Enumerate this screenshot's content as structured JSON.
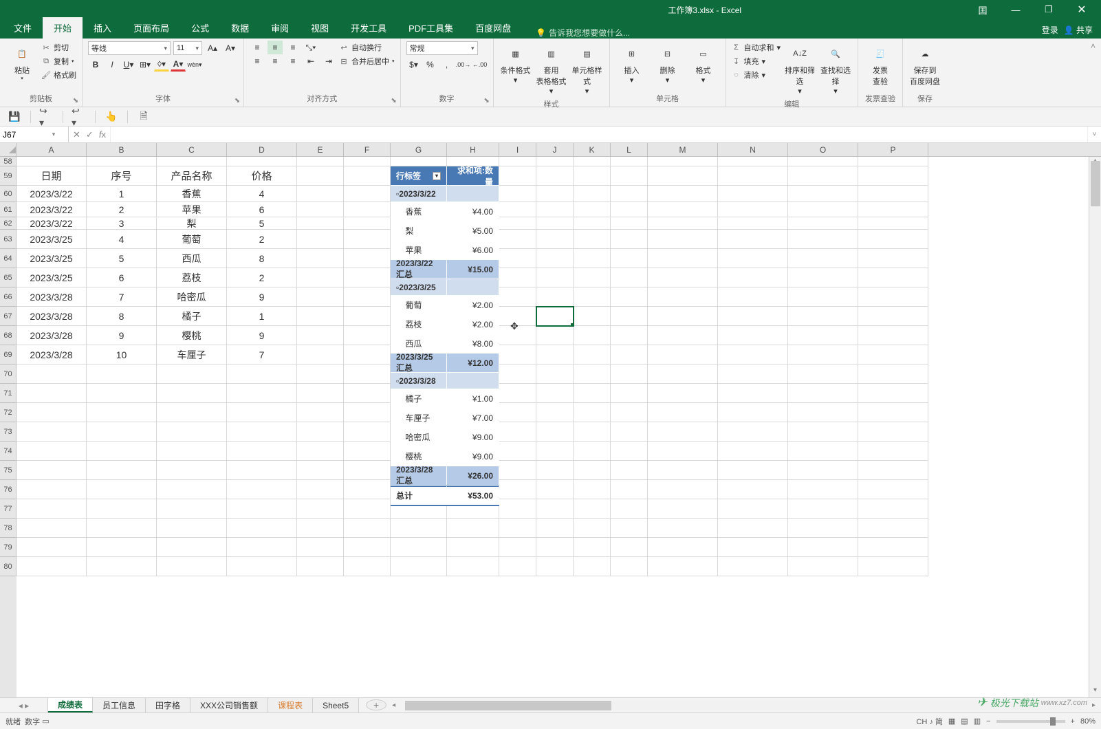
{
  "title": {
    "filename": "工作簿3.xlsx",
    "app": "Excel"
  },
  "window_buttons": {
    "account": "囯",
    "min": "—",
    "max": "❐",
    "close": "✕"
  },
  "menu_tabs": [
    "文件",
    "开始",
    "插入",
    "页面布局",
    "公式",
    "数据",
    "审阅",
    "视图",
    "开发工具",
    "PDF工具集",
    "百度网盘"
  ],
  "menu_active": "开始",
  "tell_me": "告诉我您想要做什么...",
  "login": "登录",
  "share": "共享",
  "ribbon": {
    "clipboard": {
      "paste": "粘贴",
      "cut": "剪切",
      "copy": "复制",
      "format_painter": "格式刷",
      "group": "剪贴板"
    },
    "font": {
      "name": "等线",
      "size": "11",
      "group": "字体"
    },
    "align": {
      "wrap": "自动换行",
      "merge": "合并后居中",
      "group": "对齐方式"
    },
    "number": {
      "format": "常规",
      "group": "数字"
    },
    "styles": {
      "cond": "条件格式",
      "table": "套用\n表格格式",
      "cell": "单元格样式",
      "group": "样式"
    },
    "cells": {
      "insert": "插入",
      "delete": "删除",
      "format": "格式",
      "group": "单元格"
    },
    "editing": {
      "sum": "自动求和",
      "fill": "填充",
      "clear": "清除",
      "sort": "排序和筛选",
      "find": "查找和选择",
      "group": "编辑"
    },
    "invoice": {
      "label": "发票\n查验",
      "group": "发票查验"
    },
    "save": {
      "label": "保存到\n百度网盘",
      "group": "保存"
    }
  },
  "namebox": "J67",
  "columns": [
    "A",
    "B",
    "C",
    "D",
    "E",
    "F",
    "G",
    "H",
    "I",
    "J",
    "K",
    "L",
    "M",
    "N",
    "O",
    "P"
  ],
  "row_labels": [
    "58",
    "59",
    "60",
    "61",
    "62",
    "63",
    "64",
    "65",
    "66",
    "67",
    "68",
    "69",
    "70",
    "71",
    "72",
    "73",
    "74",
    "75",
    "76",
    "77",
    "78",
    "79",
    "80"
  ],
  "table_headers": {
    "A": "日期",
    "B": "序号",
    "C": "产品名称",
    "D": "价格"
  },
  "table_rows": [
    {
      "A": "2023/3/22",
      "B": "1",
      "C": "香蕉",
      "D": "4"
    },
    {
      "A": "2023/3/22",
      "B": "2",
      "C": "苹果",
      "D": "6"
    },
    {
      "A": "2023/3/22",
      "B": "3",
      "C": "梨",
      "D": "5"
    },
    {
      "A": "2023/3/25",
      "B": "4",
      "C": "葡萄",
      "D": "2"
    },
    {
      "A": "2023/3/25",
      "B": "5",
      "C": "西瓜",
      "D": "8"
    },
    {
      "A": "2023/3/25",
      "B": "6",
      "C": "荔枝",
      "D": "2"
    },
    {
      "A": "2023/3/28",
      "B": "7",
      "C": "哈密瓜",
      "D": "9"
    },
    {
      "A": "2023/3/28",
      "B": "8",
      "C": "橘子",
      "D": "1"
    },
    {
      "A": "2023/3/28",
      "B": "9",
      "C": "樱桃",
      "D": "9"
    },
    {
      "A": "2023/3/28",
      "B": "10",
      "C": "车厘子",
      "D": "7"
    }
  ],
  "pivot": {
    "row_label": "行标签",
    "val_label": "求和项:数量",
    "groups": [
      {
        "date": "2023/3/22",
        "items": [
          {
            "n": "香蕉",
            "v": "¥4.00"
          },
          {
            "n": "梨",
            "v": "¥5.00"
          },
          {
            "n": "苹果",
            "v": "¥6.00"
          }
        ],
        "subtotal_label": "2023/3/22 汇总",
        "subtotal": "¥15.00"
      },
      {
        "date": "2023/3/25",
        "items": [
          {
            "n": "葡萄",
            "v": "¥2.00"
          },
          {
            "n": "荔枝",
            "v": "¥2.00"
          },
          {
            "n": "西瓜",
            "v": "¥8.00"
          }
        ],
        "subtotal_label": "2023/3/25 汇总",
        "subtotal": "¥12.00"
      },
      {
        "date": "2023/3/28",
        "items": [
          {
            "n": "橘子",
            "v": "¥1.00"
          },
          {
            "n": "车厘子",
            "v": "¥7.00"
          },
          {
            "n": "哈密瓜",
            "v": "¥9.00"
          },
          {
            "n": "樱桃",
            "v": "¥9.00"
          }
        ],
        "subtotal_label": "2023/3/28 汇总",
        "subtotal": "¥26.00"
      }
    ],
    "total_label": "总计",
    "total": "¥53.00"
  },
  "sheet_tabs": [
    "成绩表",
    "员工信息",
    "田字格",
    "XXX公司销售额",
    "课程表",
    "Sheet5"
  ],
  "sheet_active": "成绩表",
  "status": {
    "ready": "就绪",
    "num": "数字",
    "ime": "CH ♪ 简",
    "zoom": "80%"
  },
  "watermark": "www.xz7.com"
}
